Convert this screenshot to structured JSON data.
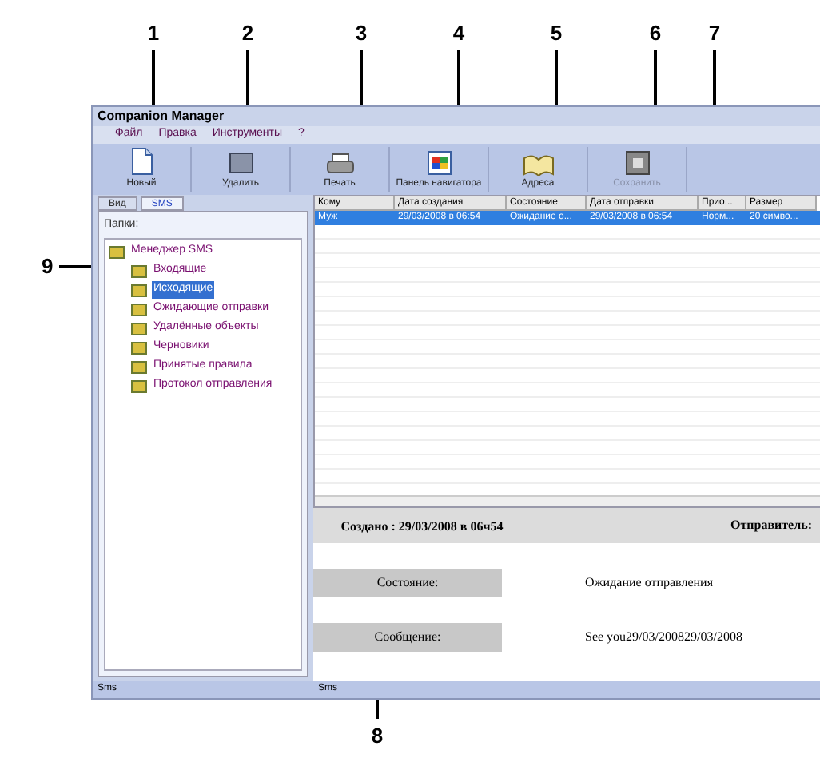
{
  "callouts": [
    {
      "label": "1",
      "kind": "top"
    },
    {
      "label": "2",
      "kind": "top"
    },
    {
      "label": "3",
      "kind": "top"
    },
    {
      "label": "4",
      "kind": "top"
    },
    {
      "label": "5",
      "kind": "top"
    },
    {
      "label": "6",
      "kind": "top"
    },
    {
      "label": "7",
      "kind": "top"
    },
    {
      "label": "8",
      "kind": "bottom"
    },
    {
      "label": "9",
      "kind": "left"
    }
  ],
  "window": {
    "title": "Companion Manager"
  },
  "menu": [
    "Файл",
    "Правка",
    "Инструменты",
    "?"
  ],
  "toolbar": [
    {
      "label": "Новый",
      "kind": "page",
      "disabled": false
    },
    {
      "label": "Удалить",
      "kind": "delete",
      "disabled": false
    },
    {
      "label": "Печать",
      "kind": "printer",
      "disabled": false
    },
    {
      "label": "Панель навигатора",
      "kind": "panel",
      "disabled": false
    },
    {
      "label": "Адреса",
      "kind": "book",
      "disabled": false
    },
    {
      "label": "Сохранить",
      "kind": "save",
      "disabled": true
    }
  ],
  "sidebar": {
    "tabs": [
      {
        "label": "Вид",
        "selected": false
      },
      {
        "label": "SMS",
        "selected": true
      }
    ],
    "label": "Папки:",
    "tree": [
      {
        "label": "Менеджер SMS",
        "selected": false,
        "children": [
          {
            "label": "Входящие",
            "selected": false
          },
          {
            "label": "Исходящие",
            "selected": true
          },
          {
            "label": "Ожидающие отправки",
            "selected": false
          },
          {
            "label": "Удалённые объекты",
            "selected": false
          },
          {
            "label": "Черновики",
            "selected": false
          },
          {
            "label": "Принятые правила",
            "selected": false
          },
          {
            "label": "Протокол отправления",
            "selected": false
          }
        ]
      }
    ]
  },
  "table": {
    "columns": [
      "Кому",
      "Дата создания",
      "Состояние",
      "Дата отправки",
      "Прио...",
      "Размер"
    ],
    "rows": [
      {
        "selected": true,
        "cells": [
          "Муж",
          "29/03/2008 в 06:54",
          "Ожидание о...",
          "29/03/2008 в 06:54",
          "Норм...",
          "20 симво..."
        ]
      }
    ]
  },
  "details": {
    "created": "Создано : 29/03/2008 в 06ч54",
    "sender_label": "Отправитель:",
    "fields": [
      {
        "label": "Состояние:",
        "value": "Ожидание отправления"
      },
      {
        "label": "Сообщение:",
        "value": "See you29/03/200829/03/2008"
      }
    ]
  },
  "status_bar": [
    "Sms",
    "Sms"
  ]
}
